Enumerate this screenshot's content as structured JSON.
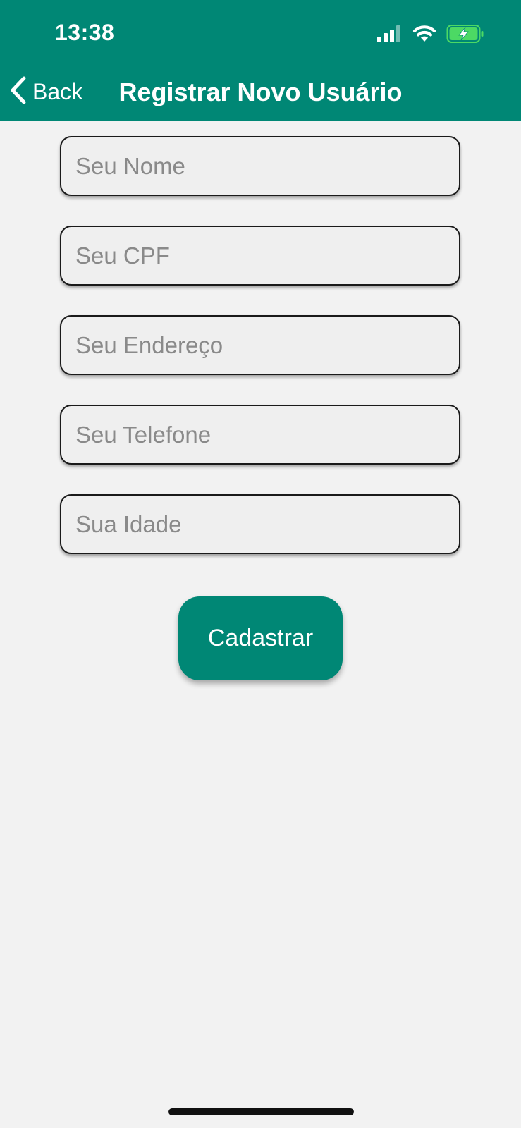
{
  "status_bar": {
    "time": "13:38",
    "icons": [
      "signal-icon",
      "wifi-icon",
      "battery-charging-icon"
    ],
    "battery_color": "#4cd964"
  },
  "nav": {
    "back_label": "Back",
    "title": "Registrar Novo Usuário"
  },
  "form": {
    "name_placeholder": "Seu Nome",
    "cpf_placeholder": "Seu CPF",
    "address_placeholder": "Seu Endereço",
    "phone_placeholder": "Seu Telefone",
    "age_placeholder": "Sua Idade",
    "submit_label": "Cadastrar"
  },
  "colors": {
    "primary": "#008775",
    "background": "#f2f2f2",
    "field_background": "#efefef",
    "placeholder": "#8a8a8a"
  }
}
